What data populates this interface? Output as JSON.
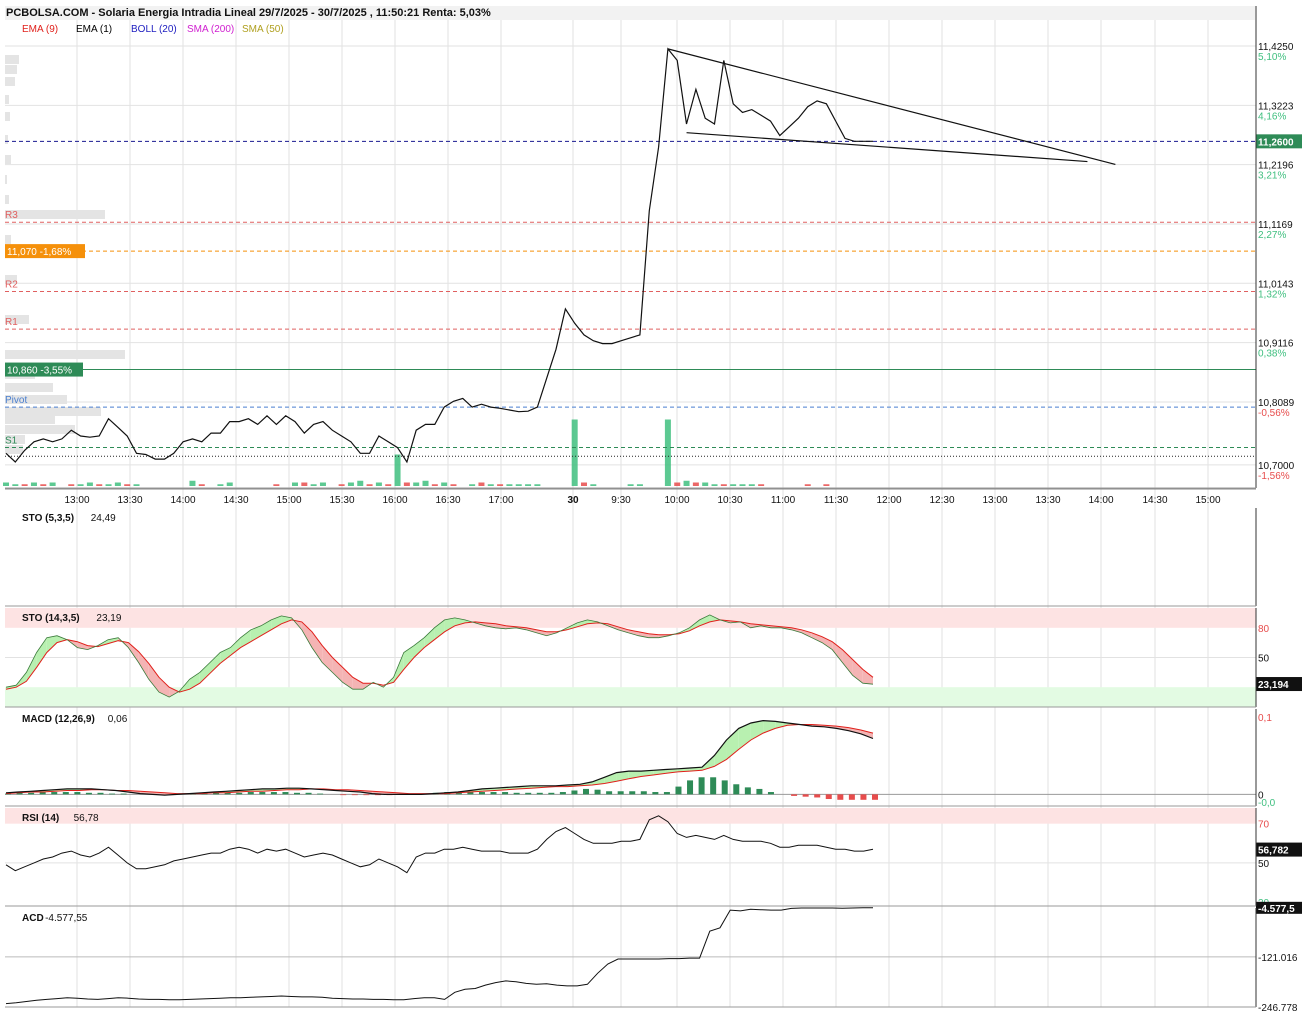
{
  "header": {
    "title": "PCBOLSA.COM - Solaria Energia Intradia Lineal 29/7/2025 - 30/7/2025 , 11:50:21 Renta: 5,03%",
    "legend": [
      {
        "label": "EMA (9)",
        "color": "#e0201b"
      },
      {
        "label": "EMA (1)",
        "color": "#000000"
      },
      {
        "label": "BOLL (20)",
        "color": "#2020c0"
      },
      {
        "label": "SMA (200)",
        "color": "#d020d0"
      },
      {
        "label": "SMA (50)",
        "color": "#b0a020"
      }
    ]
  },
  "colors": {
    "grid": "#e2e2e2",
    "up": "#3fbf7f",
    "down": "#e74c4c",
    "resistance": "#e06060",
    "support": "#2e8b57",
    "pivot": "#4a7fd0",
    "current": "#1a1a90",
    "orange": "#f5900a",
    "green_label": "#2e8b57",
    "price_label": "#2e8b57"
  },
  "chart_data": [
    {
      "type": "line",
      "panel": "price",
      "x_ticks": [
        "13:00",
        "13:30",
        "14:00",
        "14:30",
        "15:00",
        "15:30",
        "16:00",
        "16:30",
        "17:00",
        "30",
        "9:30",
        "10:00",
        "10:30",
        "11:00",
        "11:30",
        "12:00",
        "12:30",
        "13:00",
        "13:30",
        "14:00",
        "14:30",
        "15:00"
      ],
      "ylim": [
        10.66,
        11.47
      ],
      "y_ticks": [
        {
          "value": 11.425,
          "label": "11,4250",
          "pct": "5,10%"
        },
        {
          "value": 11.3223,
          "label": "11,3223",
          "pct": "4,16%"
        },
        {
          "value": 11.2196,
          "label": "11,2196",
          "pct": "3,21%"
        },
        {
          "value": 11.1169,
          "label": "11,1169",
          "pct": "2,27%"
        },
        {
          "value": 11.0143,
          "label": "11,0143",
          "pct": "1,32%"
        },
        {
          "value": 10.9116,
          "label": "10,9116",
          "pct": "0,38%"
        },
        {
          "value": 10.8089,
          "label": "10,8089",
          "pct": "-0,56%"
        },
        {
          "value": 10.7,
          "label": "10,7000",
          "pct": "-1,56%"
        }
      ],
      "levels": [
        {
          "name": "R3",
          "value": 11.12,
          "kind": "resistance"
        },
        {
          "name": "R2",
          "value": 11.0,
          "kind": "resistance"
        },
        {
          "name": "R1",
          "value": 10.935,
          "kind": "resistance"
        },
        {
          "name": "Pivot",
          "value": 10.8,
          "kind": "pivot"
        },
        {
          "name": "S1",
          "value": 10.73,
          "kind": "support"
        }
      ],
      "labelled_levels": [
        {
          "label": "11,070 -1,68%",
          "value": 11.07,
          "kind": "orange"
        },
        {
          "label": "10,860 -3,55%",
          "value": 10.865,
          "kind": "green"
        }
      ],
      "current_price": {
        "value": 11.26,
        "label": "11,2600"
      },
      "prev_close": 10.715,
      "series": [
        {
          "values": [
            10.72,
            10.705,
            10.725,
            10.74,
            10.745,
            10.74,
            10.745,
            10.76,
            10.75,
            10.748,
            10.75,
            10.78,
            10.765,
            10.75,
            10.72,
            10.718,
            10.71,
            10.71,
            10.72,
            10.74,
            10.745,
            10.74,
            10.755,
            10.755,
            10.775,
            10.775,
            10.78,
            10.77,
            10.785,
            10.77,
            10.785,
            10.775,
            10.755,
            10.77,
            10.775,
            10.76,
            10.75,
            10.74,
            10.72,
            10.72,
            10.75,
            10.74,
            10.73,
            10.705,
            10.76,
            10.77,
            10.77,
            10.8,
            10.81,
            10.815,
            10.8,
            10.805,
            10.8,
            10.798,
            10.795,
            10.792,
            10.793,
            10.8,
            10.85,
            10.9,
            10.97,
            10.945,
            10.925,
            10.915,
            10.91,
            10.91,
            10.915,
            10.92,
            10.925,
            11.14,
            11.25,
            11.42,
            11.4,
            11.29,
            11.35,
            11.3,
            11.29,
            11.4,
            11.325,
            11.31,
            11.315,
            11.305,
            11.295,
            11.27,
            11.285,
            11.3,
            11.32,
            11.33,
            11.325,
            11.295,
            11.265,
            11.26,
            11.26,
            11.26
          ]
        }
      ],
      "pennant": {
        "upper": [
          [
            71,
            11.42
          ],
          [
            119,
            11.22
          ]
        ],
        "lower": [
          [
            73,
            11.275
          ],
          [
            116,
            11.225
          ]
        ]
      },
      "volume": [
        2,
        1,
        1,
        2,
        1,
        2,
        0,
        1,
        1,
        2,
        1,
        1,
        2,
        1,
        1,
        0,
        0,
        0,
        0,
        0,
        3,
        1,
        0,
        1,
        2,
        0,
        0,
        0,
        0,
        1,
        0,
        2,
        2,
        1,
        2,
        0,
        1,
        2,
        3,
        1,
        2,
        1,
        18,
        2,
        2,
        3,
        1,
        2,
        1,
        0,
        1,
        2,
        1,
        1,
        1,
        1,
        1,
        1,
        0,
        0,
        0,
        38,
        2,
        1,
        0,
        0,
        0,
        1,
        1,
        0,
        0,
        38,
        2,
        3,
        2,
        2,
        1,
        1,
        1,
        1,
        1,
        1,
        0,
        0,
        0,
        0,
        1,
        0,
        1,
        0,
        0,
        0,
        0,
        0
      ],
      "volume_dir": [
        1,
        1,
        0,
        1,
        0,
        1,
        1,
        0,
        1,
        1,
        0,
        1,
        1,
        0,
        1,
        1,
        1,
        1,
        1,
        1,
        1,
        0,
        1,
        1,
        1,
        1,
        1,
        1,
        1,
        0,
        1,
        1,
        0,
        1,
        1,
        1,
        0,
        1,
        1,
        0,
        1,
        0,
        1,
        0,
        1,
        1,
        0,
        1,
        0,
        1,
        1,
        0,
        1,
        0,
        1,
        1,
        1,
        1,
        1,
        1,
        1,
        1,
        0,
        1,
        1,
        1,
        1,
        1,
        1,
        1,
        1,
        1,
        0,
        1,
        0,
        1,
        1,
        0,
        1,
        1,
        1,
        0,
        1,
        1,
        1,
        1,
        0,
        1,
        0,
        1,
        1,
        1,
        1,
        1
      ]
    },
    {
      "type": "line",
      "panel": "sto_fast",
      "title": "STO (5,3,5)",
      "value": "24,49",
      "series": []
    },
    {
      "type": "area",
      "panel": "sto_slow",
      "title": "STO (14,3,5)",
      "value": "23,19",
      "ylim": [
        0,
        100
      ],
      "y_ticks": [
        "80",
        "50"
      ],
      "last_label": "23,194",
      "series": [
        {
          "name": "%K",
          "values": [
            20,
            22,
            35,
            55,
            70,
            72,
            68,
            60,
            58,
            62,
            68,
            70,
            60,
            45,
            28,
            15,
            10,
            16,
            28,
            35,
            45,
            55,
            60,
            70,
            78,
            82,
            88,
            92,
            90,
            78,
            60,
            45,
            35,
            25,
            18,
            18,
            25,
            20,
            30,
            55,
            62,
            70,
            80,
            88,
            90,
            88,
            85,
            82,
            80,
            79,
            80,
            78,
            75,
            72,
            75,
            80,
            85,
            88,
            86,
            82,
            78,
            75,
            72,
            70,
            70,
            72,
            75,
            80,
            88,
            93,
            88,
            85,
            86,
            80,
            82,
            80,
            80,
            78,
            75,
            70,
            65,
            58,
            45,
            32,
            24,
            23
          ]
        },
        {
          "name": "%D",
          "values": [
            18,
            20,
            26,
            40,
            55,
            65,
            68,
            66,
            62,
            61,
            64,
            67,
            65,
            56,
            44,
            30,
            20,
            15,
            18,
            24,
            34,
            44,
            52,
            60,
            66,
            72,
            78,
            84,
            88,
            86,
            76,
            62,
            50,
            40,
            30,
            24,
            24,
            22,
            25,
            38,
            50,
            60,
            68,
            76,
            82,
            85,
            86,
            85,
            84,
            82,
            81,
            80,
            78,
            76,
            76,
            78,
            81,
            84,
            85,
            84,
            81,
            78,
            76,
            74,
            73,
            73,
            74,
            77,
            82,
            86,
            88,
            87,
            86,
            84,
            83,
            82,
            81,
            80,
            78,
            75,
            71,
            66,
            58,
            48,
            38,
            30
          ]
        }
      ]
    },
    {
      "type": "area",
      "panel": "macd",
      "title": "MACD (12,26,9)",
      "value": "0,06",
      "y_ticks": [
        {
          "value": 0.1,
          "label": "0,1"
        },
        {
          "value": 0,
          "label": "0"
        },
        {
          "value": -0.002,
          "label": "-0,0"
        }
      ],
      "ylim": [
        -0.015,
        0.11
      ],
      "macd": [
        0.002,
        0.003,
        0.004,
        0.005,
        0.006,
        0.007,
        0.007,
        0.007,
        0.006,
        0.005,
        0.003,
        0.001,
        0.0,
        -0.001,
        0.0,
        0.001,
        0.002,
        0.003,
        0.004,
        0.005,
        0.006,
        0.007,
        0.007,
        0.008,
        0.008,
        0.007,
        0.006,
        0.005,
        0.004,
        0.003,
        0.001,
        0.0,
        0.0,
        0.0,
        0.0,
        0.001,
        0.002,
        0.003,
        0.005,
        0.007,
        0.008,
        0.009,
        0.01,
        0.011,
        0.011,
        0.011,
        0.012,
        0.013,
        0.016,
        0.022,
        0.028,
        0.03,
        0.03,
        0.031,
        0.032,
        0.033,
        0.034,
        0.035,
        0.05,
        0.07,
        0.085,
        0.092,
        0.095,
        0.094,
        0.092,
        0.09,
        0.088,
        0.087,
        0.085,
        0.082,
        0.078,
        0.072
      ],
      "signal": [
        0.001,
        0.002,
        0.003,
        0.003,
        0.004,
        0.005,
        0.005,
        0.006,
        0.006,
        0.005,
        0.005,
        0.004,
        0.003,
        0.002,
        0.001,
        0.001,
        0.001,
        0.002,
        0.002,
        0.003,
        0.004,
        0.004,
        0.005,
        0.006,
        0.006,
        0.007,
        0.007,
        0.006,
        0.006,
        0.005,
        0.004,
        0.003,
        0.002,
        0.001,
        0.001,
        0.001,
        0.001,
        0.002,
        0.003,
        0.004,
        0.005,
        0.006,
        0.007,
        0.008,
        0.009,
        0.01,
        0.01,
        0.011,
        0.012,
        0.014,
        0.017,
        0.02,
        0.023,
        0.025,
        0.027,
        0.029,
        0.03,
        0.031,
        0.036,
        0.045,
        0.058,
        0.07,
        0.079,
        0.085,
        0.089,
        0.09,
        0.09,
        0.089,
        0.088,
        0.086,
        0.083,
        0.079
      ],
      "histogram": [
        1,
        2,
        2,
        3,
        3,
        3,
        3,
        2,
        2,
        1,
        1,
        0,
        0,
        0,
        0,
        1,
        1,
        1,
        2,
        2,
        2,
        3,
        3,
        3,
        3,
        2,
        2,
        1,
        0,
        -1,
        -1,
        -1,
        -1,
        -1,
        0,
        0,
        1,
        2,
        3,
        3,
        3,
        3,
        3,
        3,
        2,
        2,
        2,
        2,
        3,
        5,
        7,
        6,
        4,
        4,
        4,
        4,
        3,
        3,
        10,
        18,
        22,
        22,
        18,
        13,
        9,
        7,
        3,
        0,
        -2,
        -3,
        -4,
        -6,
        -7,
        -7,
        -7,
        -7
      ]
    },
    {
      "type": "line",
      "panel": "rsi",
      "title": "RSI (14)",
      "value": "56,78",
      "y_ticks": [
        "70",
        "50",
        "30"
      ],
      "ylim": [
        28,
        78
      ],
      "last_label": "56,782",
      "series": [
        {
          "values": [
            49,
            46,
            48,
            50,
            52,
            53,
            55,
            56,
            54,
            53,
            55,
            58,
            54,
            50,
            47,
            47,
            48,
            49,
            51,
            52,
            53,
            54,
            55,
            55,
            57,
            58,
            57,
            55,
            57,
            56,
            57,
            55,
            53,
            54,
            55,
            54,
            52,
            50,
            48,
            49,
            52,
            50,
            48,
            45,
            53,
            55,
            55,
            57,
            57,
            58,
            57,
            56,
            56,
            56,
            55,
            55,
            55,
            57,
            62,
            66,
            68,
            65,
            62,
            60,
            60,
            60,
            61,
            61,
            62,
            72,
            74,
            71,
            65,
            63,
            64,
            63,
            62,
            64,
            62,
            61,
            61,
            61,
            60,
            58,
            58,
            59,
            59,
            59,
            58,
            57,
            57,
            56,
            56,
            57
          ]
        }
      ]
    },
    {
      "type": "line",
      "panel": "acd",
      "title": "ACD",
      "value": "-4.577,55",
      "y_ticks": [
        {
          "value": -4577.5,
          "label": "-4.577,5"
        },
        {
          "value": -121016,
          "label": "-121.016"
        },
        {
          "value": -246778,
          "label": "-246.778"
        }
      ],
      "ylim": [
        -240000,
        -5000
      ],
      "series": [
        {
          "values": [
            -232000,
            -230000,
            -227000,
            -224000,
            -222000,
            -220000,
            -218000,
            -219000,
            -221000,
            -222000,
            -220000,
            -218000,
            -219000,
            -221000,
            -222000,
            -222000,
            -223000,
            -223000,
            -222000,
            -221000,
            -220000,
            -219000,
            -218000,
            -218000,
            -217000,
            -216000,
            -215000,
            -214000,
            -215000,
            -216000,
            -216000,
            -217000,
            -219000,
            -220000,
            -221000,
            -221000,
            -222000,
            -222000,
            -223000,
            -223000,
            -220000,
            -218000,
            -218000,
            -222000,
            -205000,
            -198000,
            -196000,
            -188000,
            -182000,
            -178000,
            -180000,
            -184000,
            -186000,
            -185000,
            -188000,
            -190000,
            -190000,
            -186000,
            -160000,
            -138000,
            -126000,
            -126000,
            -126000,
            -126000,
            -126000,
            -125000,
            -125000,
            -124000,
            -124000,
            -60000,
            -52000,
            -10000,
            -12000,
            -8000,
            -9000,
            -10000,
            -10000,
            -6000,
            -5000,
            -5000,
            -5000,
            -5000,
            -5500,
            -5000,
            -4500,
            -4577
          ]
        }
      ]
    }
  ]
}
